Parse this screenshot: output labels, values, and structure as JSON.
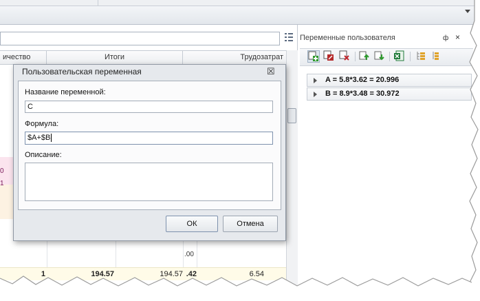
{
  "left_grid": {
    "header": {
      "col_quantity": "ичество",
      "col_totals": "Итоги",
      "col_labor": "Трудозатрат"
    },
    "side_values": [
      "0",
      "1"
    ],
    "partial_value": ".00",
    "row": {
      "c1": "1",
      "c2": "194.57",
      "c3": "194.57",
      "c4": ".42",
      "c5": "6.54"
    }
  },
  "right_panel": {
    "title": "Переменные пользователя",
    "pin_glyph": "ф",
    "close_glyph": "×",
    "toolbar": [
      {
        "icon": "add-variable-icon"
      },
      {
        "icon": "edit-variable-icon"
      },
      {
        "icon": "delete-variable-icon"
      },
      {
        "icon": "move-up-icon"
      },
      {
        "icon": "move-down-icon"
      },
      {
        "icon": "export-excel-icon"
      },
      {
        "icon": "expand-all-icon"
      },
      {
        "icon": "collapse-all-icon"
      }
    ],
    "variables": [
      {
        "text": "A  =  5.8*3.62 = 20.996"
      },
      {
        "text": "B  =  8.9*3.48 = 30.972"
      }
    ]
  },
  "dialog": {
    "title": "Пользовательская переменная",
    "close_glyph": "☒",
    "name_label": "Название переменной:",
    "name_value": "C",
    "formula_label": "Формула:",
    "formula_value": "$A+$B",
    "description_label": "Описание:",
    "description_value": "",
    "ok_label": "ОК",
    "cancel_label": "Отмена"
  },
  "colors": {
    "accent_border": "#7d91ad",
    "excel_green": "#1f7a3a",
    "add_green": "#2e9a2e",
    "delete_red": "#c2262c"
  }
}
